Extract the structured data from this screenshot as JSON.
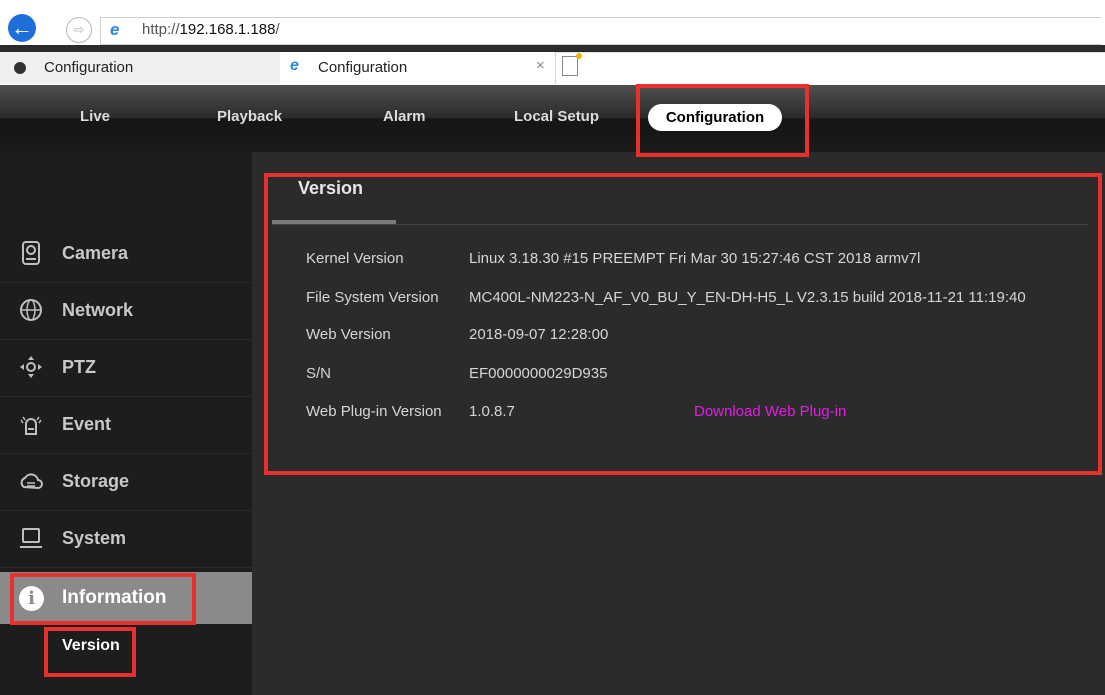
{
  "browser": {
    "url_prefix": "http://",
    "url_host": "192.168.1.188",
    "url_suffix": "/",
    "tabs": [
      {
        "label": "Configuration"
      },
      {
        "label": "Configuration"
      }
    ]
  },
  "topnav": {
    "items": [
      "Live",
      "Playback",
      "Alarm",
      "Local Setup"
    ],
    "active": "Configuration"
  },
  "sidebar": {
    "items": [
      "Camera",
      "Network",
      "PTZ",
      "Event",
      "Storage",
      "System"
    ],
    "active": "Information",
    "sub_active": "Version"
  },
  "main": {
    "tab": "Version",
    "rows": [
      {
        "label": "Kernel Version",
        "value": "Linux 3.18.30 #15 PREEMPT Fri Mar 30 15:27:46 CST 2018 armv7l"
      },
      {
        "label": "File System Version",
        "value": "MC400L-NM223-N_AF_V0_BU_Y_EN-DH-H5_L V2.3.15 build 2018-11-21 11:19:40"
      },
      {
        "label": "Web Version",
        "value": "2018-09-07 12:28:00"
      },
      {
        "label": "S/N",
        "value": "EF0000000029D935"
      },
      {
        "label": "Web Plug-in Version",
        "value": "1.0.8.7"
      }
    ],
    "download_link": "Download Web Plug-in"
  },
  "colors": {
    "highlight": "#e8302f",
    "link": "#e41de4",
    "accent_blue": "#1e6fd9"
  }
}
